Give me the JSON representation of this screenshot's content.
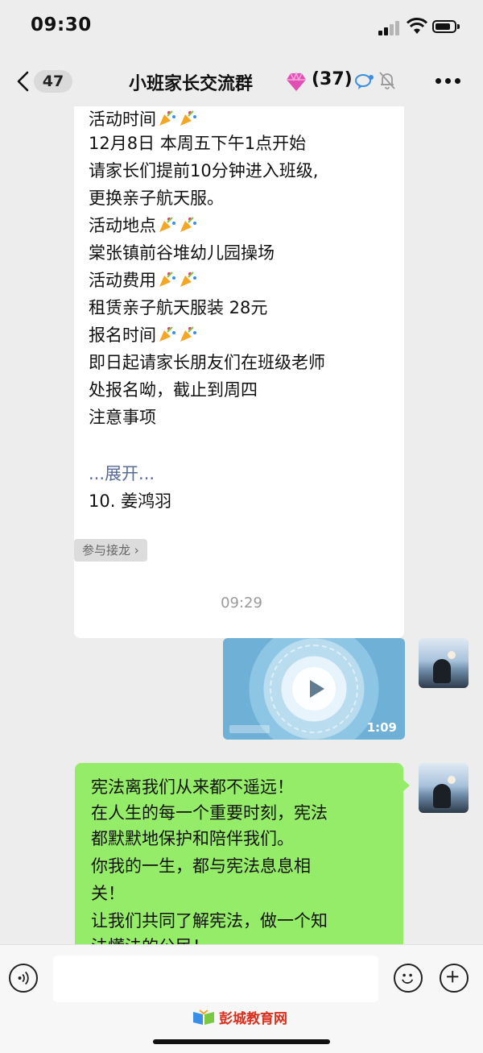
{
  "status_bar": {
    "time": "09:30"
  },
  "nav": {
    "unread_count": "47",
    "title": "小班家长交流群",
    "member_count": "(37)"
  },
  "card": {
    "lines": [
      "活动时间",
      "12月8日 本周五下午1点开始",
      "请家长们提前10分钟进入班级,",
      "更换亲子航天服。",
      "活动地点",
      "棠张镇前谷堆幼儿园操场",
      "活动费用",
      "租赁亲子航天服装 28元",
      "报名时间",
      "即日起请家长朋友们在班级老师",
      "处报名呦，截止到周四",
      "注意事项",
      "...展开...",
      "10. 姜鸿羽"
    ]
  },
  "join_chip": "参与接龙 ›",
  "timestamp": "09:29",
  "video": {
    "duration": "1:09"
  },
  "message": {
    "lines": [
      "宪法离我们从来都不遥远！",
      "在人生的每一个重要时刻，宪法",
      "都默默地保护和陪伴我们。",
      "你我的一生，都与宪法息息相",
      "关！",
      "让我们共同了解宪法，做一个知",
      "法懂法的公民！"
    ]
  },
  "input": {
    "value": ""
  },
  "watermark": "彭城教育网",
  "colors": {
    "bubble_green": "#95ec69",
    "link_blue": "#576b95",
    "background": "#ededed"
  }
}
